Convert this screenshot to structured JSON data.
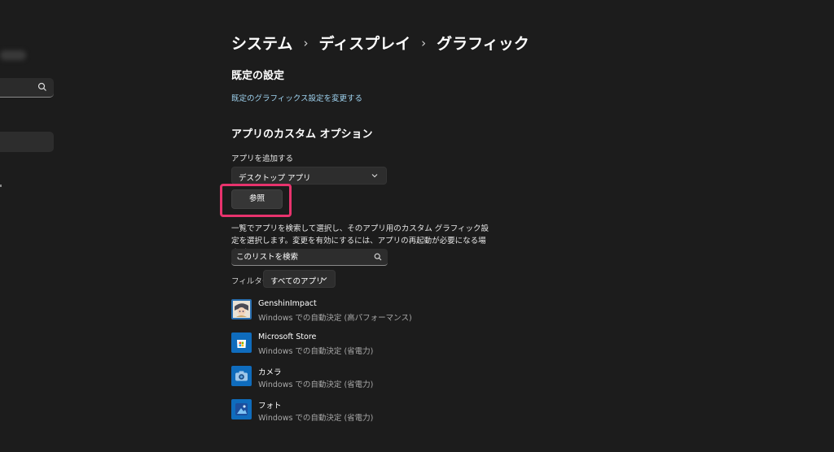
{
  "breadcrumb": [
    "システム",
    "ディスプレイ",
    "グラフィック"
  ],
  "default_section": {
    "title": "既定の設定",
    "link": "既定のグラフィックス設定を変更する"
  },
  "custom_section": {
    "title": "アプリのカスタム オプション",
    "add_app_label": "アプリを追加する",
    "app_type_selected": "デスクトップ アプリ",
    "browse_label": "参照",
    "description": "一覧でアプリを検索して選択し、そのアプリ用のカスタム グラフィック設定を選択します。変更を有効にするには、アプリの再起動が必要になる場合があります。",
    "search_placeholder": "このリストを検索",
    "filter_label": "フィルター:",
    "filter_selected": "すべてのアプリ"
  },
  "apps": [
    {
      "name": "GenshinImpact",
      "status": "Windows での自動決定 (高パフォーマンス)",
      "icon": "genshin-impact-icon"
    },
    {
      "name": "Microsoft Store",
      "status": "Windows での自動決定 (省電力)",
      "icon": "microsoft-store-icon"
    },
    {
      "name": "カメラ",
      "status": "Windows での自動決定 (省電力)",
      "icon": "camera-icon"
    },
    {
      "name": "フォト",
      "status": "Windows での自動決定 (省電力)",
      "icon": "photos-icon"
    }
  ],
  "colors": {
    "background": "#1c1c1c",
    "link": "#9fd3f0",
    "highlight": "#e8336d"
  }
}
